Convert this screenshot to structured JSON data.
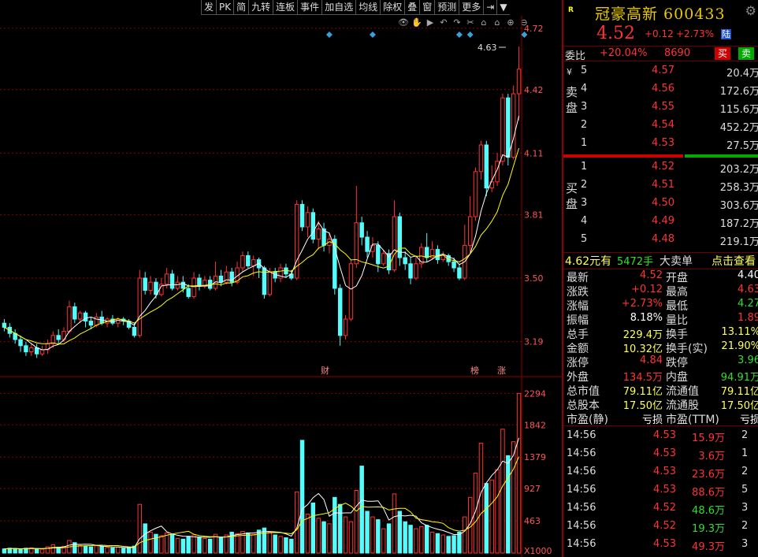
{
  "toolbar": {
    "items": [
      "发",
      "PK",
      "简",
      "九转",
      "连板",
      "事件",
      "加自选",
      "均线",
      "除权",
      "叠",
      "窗",
      "预测",
      "更多",
      "⇥",
      "▼"
    ]
  },
  "price_axis": [
    "4.72",
    "4.42",
    "4.11",
    "3.81",
    "3.50",
    "3.19"
  ],
  "volume_axis": [
    "2294",
    "1842",
    "1379",
    "927",
    "463",
    "X1000"
  ],
  "chart": {
    "high_marker": "4.63",
    "event_labels": {
      "cai": "财",
      "bang": "榜",
      "zhang": "涨"
    }
  },
  "chart_data": {
    "type": "candlestick",
    "ylim": [
      3.05,
      4.75
    ],
    "volume_ylim": [
      0,
      2400
    ],
    "candles": [
      {
        "o": 3.28,
        "c": 3.26,
        "h": 3.3,
        "l": 3.24,
        "v": 60
      },
      {
        "o": 3.26,
        "c": 3.23,
        "h": 3.28,
        "l": 3.21,
        "v": 70
      },
      {
        "o": 3.23,
        "c": 3.2,
        "h": 3.25,
        "l": 3.18,
        "v": 65
      },
      {
        "o": 3.2,
        "c": 3.17,
        "h": 3.22,
        "l": 3.14,
        "v": 55
      },
      {
        "o": 3.17,
        "c": 3.14,
        "h": 3.19,
        "l": 3.12,
        "v": 70
      },
      {
        "o": 3.14,
        "c": 3.16,
        "h": 3.18,
        "l": 3.12,
        "v": 75
      },
      {
        "o": 3.16,
        "c": 3.13,
        "h": 3.18,
        "l": 3.11,
        "v": 60
      },
      {
        "o": 3.13,
        "c": 3.15,
        "h": 3.17,
        "l": 3.12,
        "v": 55
      },
      {
        "o": 3.15,
        "c": 3.18,
        "h": 3.2,
        "l": 3.13,
        "v": 90
      },
      {
        "o": 3.18,
        "c": 3.22,
        "h": 3.24,
        "l": 3.16,
        "v": 120
      },
      {
        "o": 3.22,
        "c": 3.2,
        "h": 3.25,
        "l": 3.18,
        "v": 85
      },
      {
        "o": 3.2,
        "c": 3.24,
        "h": 3.26,
        "l": 3.19,
        "v": 95
      },
      {
        "o": 3.24,
        "c": 3.36,
        "h": 3.39,
        "l": 3.23,
        "v": 180
      },
      {
        "o": 3.36,
        "c": 3.3,
        "h": 3.38,
        "l": 3.28,
        "v": 150
      },
      {
        "o": 3.3,
        "c": 3.33,
        "h": 3.34,
        "l": 3.28,
        "v": 110
      },
      {
        "o": 3.33,
        "c": 3.29,
        "h": 3.34,
        "l": 3.26,
        "v": 100
      },
      {
        "o": 3.29,
        "c": 3.27,
        "h": 3.31,
        "l": 3.25,
        "v": 90
      },
      {
        "o": 3.27,
        "c": 3.31,
        "h": 3.33,
        "l": 3.26,
        "v": 105
      },
      {
        "o": 3.31,
        "c": 3.28,
        "h": 3.34,
        "l": 3.27,
        "v": 95
      },
      {
        "o": 3.28,
        "c": 3.3,
        "h": 3.31,
        "l": 3.26,
        "v": 80
      },
      {
        "o": 3.3,
        "c": 3.28,
        "h": 3.32,
        "l": 3.27,
        "v": 75
      },
      {
        "o": 3.28,
        "c": 3.3,
        "h": 3.31,
        "l": 3.26,
        "v": 85
      },
      {
        "o": 3.3,
        "c": 3.29,
        "h": 3.31,
        "l": 3.27,
        "v": 70
      },
      {
        "o": 3.29,
        "c": 3.26,
        "h": 3.3,
        "l": 3.25,
        "v": 80
      },
      {
        "o": 3.26,
        "c": 3.22,
        "h": 3.28,
        "l": 3.21,
        "v": 100
      },
      {
        "o": 3.22,
        "c": 3.5,
        "h": 3.54,
        "l": 3.21,
        "v": 700
      },
      {
        "o": 3.5,
        "c": 3.44,
        "h": 3.53,
        "l": 3.42,
        "v": 420
      },
      {
        "o": 3.44,
        "c": 3.48,
        "h": 3.51,
        "l": 3.42,
        "v": 300
      },
      {
        "o": 3.48,
        "c": 3.42,
        "h": 3.5,
        "l": 3.4,
        "v": 270
      },
      {
        "o": 3.42,
        "c": 3.47,
        "h": 3.5,
        "l": 3.41,
        "v": 250
      },
      {
        "o": 3.47,
        "c": 3.52,
        "h": 3.55,
        "l": 3.45,
        "v": 290
      },
      {
        "o": 3.52,
        "c": 3.45,
        "h": 3.54,
        "l": 3.44,
        "v": 260
      },
      {
        "o": 3.45,
        "c": 3.48,
        "h": 3.51,
        "l": 3.44,
        "v": 210
      },
      {
        "o": 3.48,
        "c": 3.45,
        "h": 3.51,
        "l": 3.43,
        "v": 200
      },
      {
        "o": 3.45,
        "c": 3.41,
        "h": 3.47,
        "l": 3.4,
        "v": 240
      },
      {
        "o": 3.41,
        "c": 3.5,
        "h": 3.53,
        "l": 3.4,
        "v": 260
      },
      {
        "o": 3.5,
        "c": 3.46,
        "h": 3.52,
        "l": 3.44,
        "v": 230
      },
      {
        "o": 3.46,
        "c": 3.49,
        "h": 3.51,
        "l": 3.45,
        "v": 210
      },
      {
        "o": 3.49,
        "c": 3.45,
        "h": 3.51,
        "l": 3.44,
        "v": 200
      },
      {
        "o": 3.45,
        "c": 3.51,
        "h": 3.58,
        "l": 3.44,
        "v": 270
      },
      {
        "o": 3.51,
        "c": 3.48,
        "h": 3.54,
        "l": 3.46,
        "v": 220
      },
      {
        "o": 3.48,
        "c": 3.53,
        "h": 3.56,
        "l": 3.47,
        "v": 260
      },
      {
        "o": 3.53,
        "c": 3.48,
        "h": 3.55,
        "l": 3.46,
        "v": 300
      },
      {
        "o": 3.48,
        "c": 3.55,
        "h": 3.58,
        "l": 3.47,
        "v": 280
      },
      {
        "o": 3.55,
        "c": 3.61,
        "h": 3.63,
        "l": 3.53,
        "v": 310
      },
      {
        "o": 3.61,
        "c": 3.56,
        "h": 3.63,
        "l": 3.55,
        "v": 290
      },
      {
        "o": 3.56,
        "c": 3.59,
        "h": 3.61,
        "l": 3.51,
        "v": 270
      },
      {
        "o": 3.59,
        "c": 3.55,
        "h": 3.6,
        "l": 3.5,
        "v": 330
      },
      {
        "o": 3.55,
        "c": 3.42,
        "h": 3.56,
        "l": 3.4,
        "v": 360
      },
      {
        "o": 3.42,
        "c": 3.53,
        "h": 3.55,
        "l": 3.41,
        "v": 300
      },
      {
        "o": 3.53,
        "c": 3.5,
        "h": 3.55,
        "l": 3.48,
        "v": 260
      },
      {
        "o": 3.5,
        "c": 3.55,
        "h": 3.57,
        "l": 3.48,
        "v": 240
      },
      {
        "o": 3.55,
        "c": 3.52,
        "h": 3.57,
        "l": 3.5,
        "v": 220
      },
      {
        "o": 3.52,
        "c": 3.5,
        "h": 3.54,
        "l": 3.49,
        "v": 200
      },
      {
        "o": 3.5,
        "c": 3.86,
        "h": 3.88,
        "l": 3.49,
        "v": 880
      },
      {
        "o": 3.86,
        "c": 3.75,
        "h": 3.88,
        "l": 3.73,
        "v": 1620
      },
      {
        "o": 3.75,
        "c": 3.82,
        "h": 3.85,
        "l": 3.7,
        "v": 560
      },
      {
        "o": 3.82,
        "c": 3.69,
        "h": 3.84,
        "l": 3.67,
        "v": 720
      },
      {
        "o": 3.69,
        "c": 3.74,
        "h": 3.78,
        "l": 3.64,
        "v": 500
      },
      {
        "o": 3.74,
        "c": 3.66,
        "h": 3.77,
        "l": 3.63,
        "v": 450
      },
      {
        "o": 3.66,
        "c": 3.69,
        "h": 3.72,
        "l": 3.62,
        "v": 420
      },
      {
        "o": 3.69,
        "c": 3.45,
        "h": 3.71,
        "l": 3.42,
        "v": 800
      },
      {
        "o": 3.45,
        "c": 3.22,
        "h": 3.47,
        "l": 3.17,
        "v": 700
      },
      {
        "o": 3.22,
        "c": 3.3,
        "h": 3.32,
        "l": 3.2,
        "v": 520
      },
      {
        "o": 3.3,
        "c": 3.57,
        "h": 3.59,
        "l": 3.29,
        "v": 450
      },
      {
        "o": 3.57,
        "c": 3.77,
        "h": 3.95,
        "l": 3.55,
        "v": 900
      },
      {
        "o": 3.77,
        "c": 3.7,
        "h": 3.8,
        "l": 3.66,
        "v": 1250
      },
      {
        "o": 3.7,
        "c": 3.63,
        "h": 3.73,
        "l": 3.6,
        "v": 600
      },
      {
        "o": 3.63,
        "c": 3.66,
        "h": 3.7,
        "l": 3.6,
        "v": 520
      },
      {
        "o": 3.66,
        "c": 3.57,
        "h": 3.68,
        "l": 3.53,
        "v": 480
      },
      {
        "o": 3.57,
        "c": 3.62,
        "h": 3.64,
        "l": 3.56,
        "v": 350
      },
      {
        "o": 3.62,
        "c": 3.54,
        "h": 3.64,
        "l": 3.52,
        "v": 420
      },
      {
        "o": 3.54,
        "c": 3.8,
        "h": 3.88,
        "l": 3.53,
        "v": 850
      },
      {
        "o": 3.8,
        "c": 3.6,
        "h": 3.82,
        "l": 3.56,
        "v": 600
      },
      {
        "o": 3.6,
        "c": 3.57,
        "h": 3.63,
        "l": 3.54,
        "v": 450
      },
      {
        "o": 3.57,
        "c": 3.5,
        "h": 3.6,
        "l": 3.47,
        "v": 400
      },
      {
        "o": 3.5,
        "c": 3.57,
        "h": 3.61,
        "l": 3.49,
        "v": 350
      },
      {
        "o": 3.57,
        "c": 3.65,
        "h": 3.67,
        "l": 3.55,
        "v": 380
      },
      {
        "o": 3.65,
        "c": 3.6,
        "h": 3.72,
        "l": 3.58,
        "v": 400
      },
      {
        "o": 3.6,
        "c": 3.64,
        "h": 3.68,
        "l": 3.59,
        "v": 300
      },
      {
        "o": 3.64,
        "c": 3.59,
        "h": 3.66,
        "l": 3.57,
        "v": 280
      },
      {
        "o": 3.59,
        "c": 3.61,
        "h": 3.63,
        "l": 3.58,
        "v": 260
      },
      {
        "o": 3.61,
        "c": 3.58,
        "h": 3.62,
        "l": 3.56,
        "v": 240
      },
      {
        "o": 3.58,
        "c": 3.55,
        "h": 3.6,
        "l": 3.53,
        "v": 250
      },
      {
        "o": 3.55,
        "c": 3.5,
        "h": 3.57,
        "l": 3.49,
        "v": 300
      },
      {
        "o": 3.5,
        "c": 3.66,
        "h": 3.76,
        "l": 3.49,
        "v": 520
      },
      {
        "o": 3.66,
        "c": 3.8,
        "h": 3.9,
        "l": 3.62,
        "v": 800
      },
      {
        "o": 3.8,
        "c": 4.02,
        "h": 4.04,
        "l": 3.78,
        "v": 1150
      },
      {
        "o": 4.02,
        "c": 4.15,
        "h": 4.17,
        "l": 3.98,
        "v": 1580
      },
      {
        "o": 4.15,
        "c": 3.94,
        "h": 4.17,
        "l": 3.9,
        "v": 1000
      },
      {
        "o": 3.94,
        "c": 3.97,
        "h": 4.05,
        "l": 3.92,
        "v": 1050
      },
      {
        "o": 3.97,
        "c": 4.07,
        "h": 4.11,
        "l": 3.95,
        "v": 1200
      },
      {
        "o": 4.07,
        "c": 4.38,
        "h": 4.4,
        "l": 4.05,
        "v": 1780
      },
      {
        "o": 4.38,
        "c": 4.09,
        "h": 4.4,
        "l": 4.05,
        "v": 1400
      },
      {
        "o": 4.09,
        "c": 4.4,
        "h": 4.44,
        "l": 4.08,
        "v": 1600
      },
      {
        "o": 4.4,
        "c": 4.52,
        "h": 4.63,
        "l": 4.27,
        "v": 2294
      }
    ]
  },
  "panel": {
    "badge": "R",
    "name": "冠豪高新 600433",
    "price": "4.52",
    "change": "+0.12",
    "change_pct": "+2.73%",
    "exchange_tag": "陆",
    "wb_label": "委比",
    "wb_pct": "+20.04%",
    "wb_num": "8690",
    "buy_btn": "买",
    "sell_btn": "卖",
    "yen": "¥",
    "sell_side_label": "卖盘",
    "buy_side_label": "买盘",
    "asks": [
      {
        "lvl": "5",
        "px": "4.57",
        "vol": "20.4万"
      },
      {
        "lvl": "4",
        "px": "4.56",
        "vol": "172.6万"
      },
      {
        "lvl": "3",
        "px": "4.55",
        "vol": "115.6万"
      },
      {
        "lvl": "2",
        "px": "4.54",
        "vol": "452.2万"
      },
      {
        "lvl": "1",
        "px": "4.53",
        "vol": "27.5万"
      }
    ],
    "bids": [
      {
        "lvl": "1",
        "px": "4.52",
        "vol": "203.2万"
      },
      {
        "lvl": "2",
        "px": "4.51",
        "vol": "258.3万"
      },
      {
        "lvl": "3",
        "px": "4.50",
        "vol": "303.6万"
      },
      {
        "lvl": "4",
        "px": "4.49",
        "vol": "187.2万"
      },
      {
        "lvl": "5",
        "px": "4.48",
        "vol": "219.1万"
      }
    ],
    "deal": {
      "price": "4.62元有",
      "qty": "5472手",
      "type": "大卖单",
      "hint": "点击查看"
    },
    "stats": [
      {
        "l1": "最新",
        "v1": "4.52",
        "c1": "#ff3333",
        "l2": "开盘",
        "v2": "4.40",
        "c2": "#ffffff"
      },
      {
        "l1": "涨跌",
        "v1": "+0.12",
        "c1": "#ff3333",
        "l2": "最高",
        "v2": "4.63",
        "c2": "#ff3333"
      },
      {
        "l1": "涨幅",
        "v1": "+2.73%",
        "c1": "#ff3333",
        "l2": "最低",
        "v2": "4.27",
        "c2": "#33dd33"
      },
      {
        "l1": "振幅",
        "v1": "8.18%",
        "c1": "#ffffff",
        "l2": "量比",
        "v2": "1.89",
        "c2": "#ff3333"
      },
      {
        "l1": "总手",
        "v1": "229.4万",
        "c1": "#ffff55",
        "l2": "换手",
        "v2": "13.11%",
        "c2": "#ffff55"
      },
      {
        "l1": "金额",
        "v1": "10.32亿",
        "c1": "#ffff55",
        "l2": "换手(实)",
        "v2": "21.90%",
        "c2": "#ffff55"
      },
      {
        "l1": "涨停",
        "v1": "4.84",
        "c1": "#ff3333",
        "l2": "跌停",
        "v2": "3.96",
        "c2": "#33dd33"
      },
      {
        "l1": "外盘",
        "v1": "134.5万",
        "c1": "#ff3333",
        "l2": "内盘",
        "v2": "94.91万",
        "c2": "#33dd33"
      },
      {
        "l1": "总市值",
        "v1": "79.11亿",
        "c1": "#ffff55",
        "l2": "流通值",
        "v2": "79.11亿",
        "c2": "#ffff55"
      },
      {
        "l1": "总股本",
        "v1": "17.50亿",
        "c1": "#ffff55",
        "l2": "流通股",
        "v2": "17.50亿",
        "c2": "#ffff55"
      },
      {
        "l1": "市盈(静)",
        "v1": "亏损",
        "c1": "#ffffff",
        "l2": "市盈(TTM)",
        "v2": "亏损",
        "c2": "#ffffff"
      }
    ],
    "ticks": [
      {
        "t": "14:56",
        "p": "4.53",
        "v": "15.9万",
        "vc": "#ff3333",
        "n": "2"
      },
      {
        "t": "14:56",
        "p": "4.53",
        "v": "3.6万",
        "vc": "#ff3333",
        "n": "1"
      },
      {
        "t": "14:56",
        "p": "4.53",
        "v": "23.6万",
        "vc": "#ff3333",
        "n": "2"
      },
      {
        "t": "14:56",
        "p": "4.53",
        "v": "88.6万",
        "vc": "#ff3333",
        "n": "5"
      },
      {
        "t": "14:56",
        "p": "4.52",
        "v": "48.6万",
        "vc": "#33dd33",
        "n": "3"
      },
      {
        "t": "14:56",
        "p": "4.52",
        "v": "19.3万",
        "vc": "#33dd33",
        "n": "2"
      },
      {
        "t": "14:56",
        "p": "4.53",
        "v": "49.3万",
        "vc": "#ff3333",
        "n": "3"
      }
    ]
  },
  "colors": {
    "up": "#ff3333",
    "down": "#54fcfc",
    "ma5": "#ffffff",
    "ma10": "#ffff00",
    "grid": "#8b0000"
  }
}
